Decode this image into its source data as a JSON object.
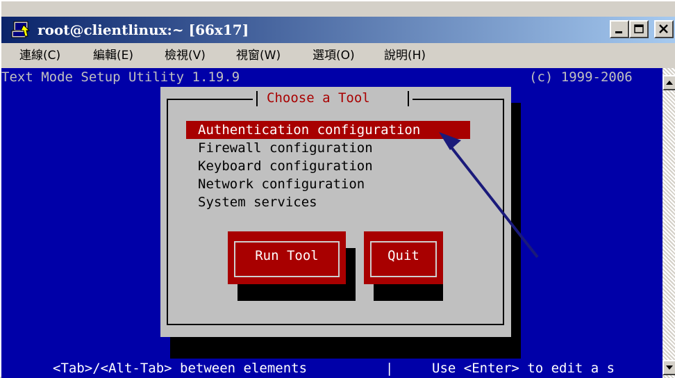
{
  "window": {
    "title": "root@clientlinux:~ [66x17]",
    "colors": {
      "title_start": "#0a246a",
      "title_end": "#a6caf0",
      "terminal_bg": "#0000a8",
      "dialog_bg": "#c0c0c0",
      "accent_red": "#a80000"
    }
  },
  "menubar": {
    "items": [
      "連線(C)",
      "編輯(E)",
      "檢視(V)",
      "視窗(W)",
      "選項(O)",
      "說明(H)"
    ]
  },
  "terminal": {
    "header_left": "Text Mode Setup Utility 1.19.9",
    "header_right": "(c) 1999-2006",
    "status_left": "<Tab>/<Alt-Tab> between elements",
    "status_sep": "|",
    "status_right": "Use <Enter> to edit a s"
  },
  "dialog": {
    "title": "Choose a Tool",
    "items": [
      "Authentication configuration",
      "Firewall configuration",
      "Keyboard configuration",
      "Network configuration",
      "System services"
    ],
    "selected_index": 0,
    "buttons": {
      "run": "Run Tool",
      "quit": "Quit"
    }
  },
  "icons": {
    "app": "putty-terminal-icon",
    "minimize": "minimize-icon",
    "maximize": "maximize-icon",
    "close": "close-icon",
    "scroll_up": "scroll-up-arrow-icon",
    "scroll_down": "scroll-down-arrow-icon",
    "annotation": "annotation-arrow"
  }
}
